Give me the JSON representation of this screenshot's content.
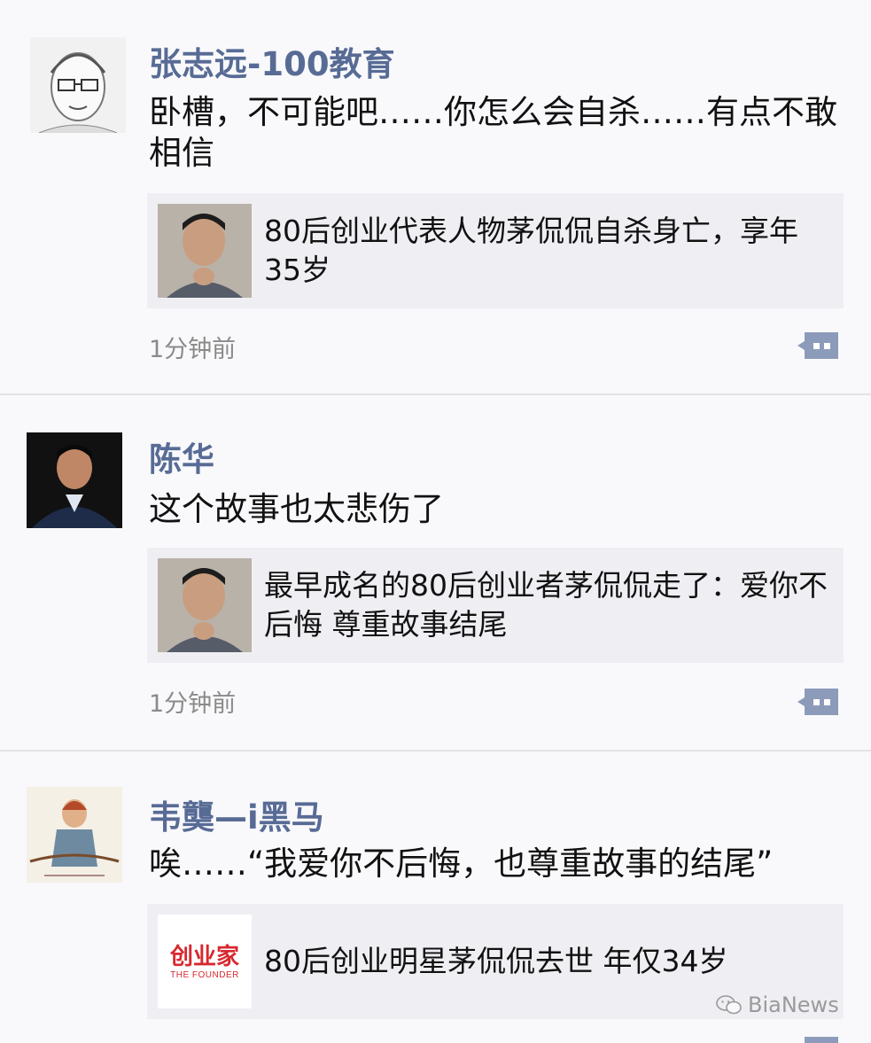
{
  "posts": [
    {
      "author": "张志远-100教育",
      "text": "卧槽，不可能吧……你怎么会自杀……有点不敢相信",
      "link_title": "80后创业代表人物茅侃侃自杀身亡，享年35岁",
      "time": "1分钟前"
    },
    {
      "author": "陈华",
      "text": "这个故事也太悲伤了",
      "link_title": "最早成名的80后创业者茅侃侃走了：爱你不后悔 尊重故事结尾",
      "time": "1分钟前"
    },
    {
      "author": "韦龑—i黑马",
      "text": "唉……“我爱你不后悔，也尊重故事的结尾”",
      "link_title": "80后创业明星茅侃侃去世 年仅34岁",
      "logo_cn": "创业家",
      "logo_en": "THE FOUNDER"
    }
  ],
  "watermark": "BiaNews",
  "colors": {
    "name": "#576b95",
    "comment_icon": "#8c9bb9",
    "logo_red": "#d7282f"
  },
  "icons": [
    "comment-icon",
    "wechat-icon"
  ]
}
